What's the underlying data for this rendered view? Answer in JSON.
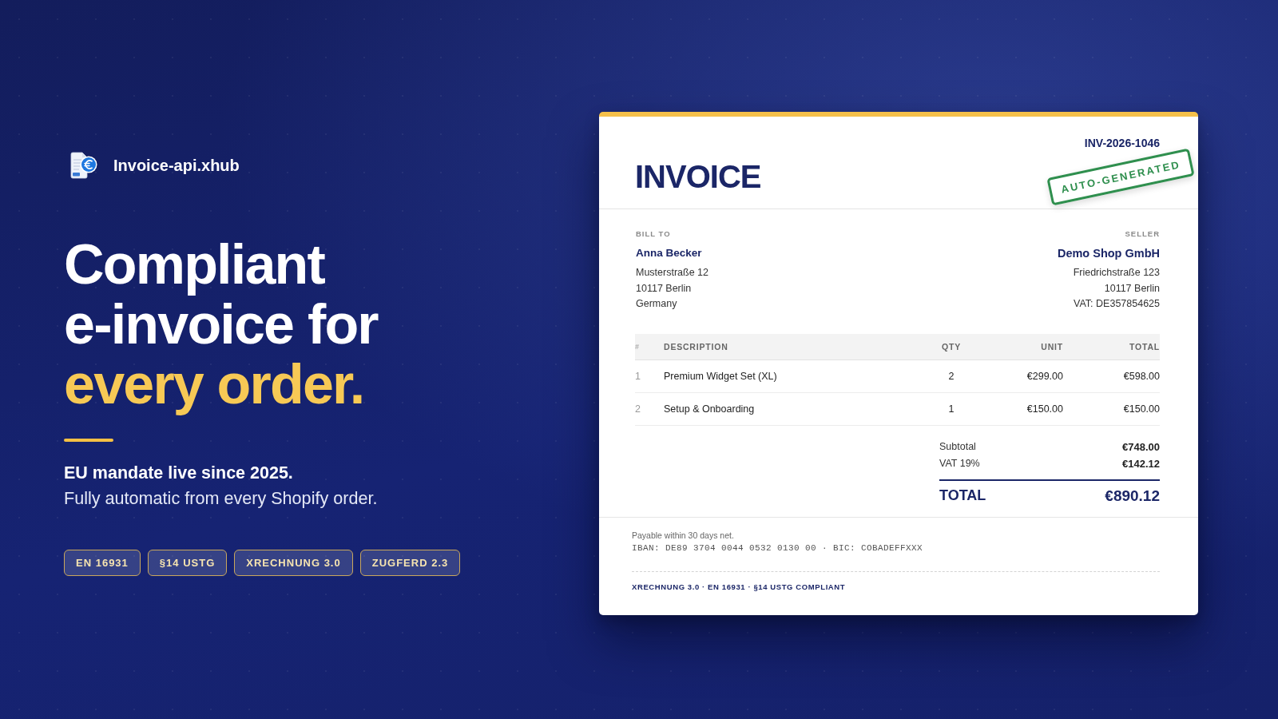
{
  "brand": {
    "name": "Invoice-api.xhub"
  },
  "hero": {
    "headline": [
      {
        "text": "Compliant",
        "highlight": false
      },
      {
        "text": "e-invoice for",
        "highlight": false
      },
      {
        "text": "every order.",
        "highlight": true
      }
    ],
    "lead": "EU mandate live since 2025.",
    "subline": "Fully automatic from every Shopify order."
  },
  "badges": [
    "EN 16931",
    "§14 USTG",
    "XRECHNUNG 3.0",
    "ZUGFERD 2.3"
  ],
  "invoice": {
    "title": "INVOICE",
    "number": "INV-2026-1046",
    "stamp": "AUTO-GENERATED",
    "bill_to": {
      "label": "BILL TO",
      "name": "Anna Becker",
      "lines": [
        "Musterstraße 12",
        "10117 Berlin",
        "Germany"
      ]
    },
    "seller": {
      "label": "SELLER",
      "name": "Demo Shop GmbH",
      "lines": [
        "Friedrichstraße 123",
        "10117 Berlin",
        "VAT: DE357854625"
      ]
    },
    "table": {
      "columns": [
        "#",
        "DESCRIPTION",
        "QTY",
        "UNIT",
        "TOTAL"
      ],
      "rows": [
        [
          "1",
          "Premium Widget Set (XL)",
          "2",
          "€299.00",
          "€598.00"
        ],
        [
          "2",
          "Setup & Onboarding",
          "1",
          "€150.00",
          "€150.00"
        ]
      ]
    },
    "totals": [
      {
        "label": "Subtotal",
        "value": "€748.00"
      },
      {
        "label": "VAT 19%",
        "value": "€142.12"
      }
    ],
    "grand_total": {
      "label": "TOTAL",
      "value": "€890.12"
    },
    "footer": {
      "terms": "Payable within 30 days net.",
      "bank": "IBAN: DE89 3704 0044 0532 0130 00 · BIC: COBADEFFXXX",
      "compliance": "XRECHNUNG 3.0 · EN 16931 · §14 USTG COMPLIANT"
    }
  }
}
